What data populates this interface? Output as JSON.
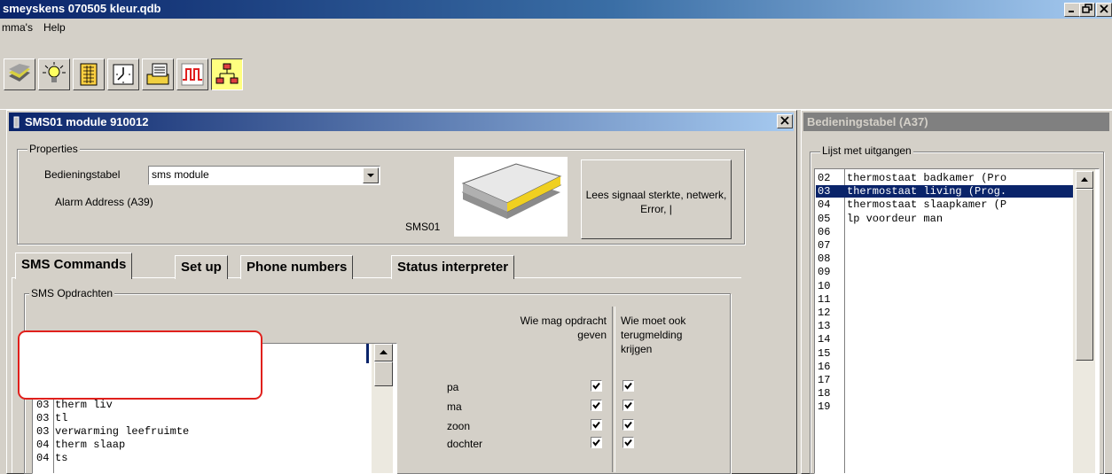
{
  "window": {
    "title": "smeyskens 070505 kleur.qdb",
    "min": "_",
    "max": "□",
    "close": "×"
  },
  "menu": [
    "mma's",
    "Help"
  ],
  "toolbar": {
    "icons": [
      "modules-icon",
      "lamp-icon",
      "table-icon",
      "clock-icon",
      "list-icon",
      "graph-icon",
      "network-icon"
    ]
  },
  "module": {
    "title": "SMS01 module 910012",
    "properties_legend": "Properties",
    "bedieningstabel_label": "Bedieningstabel",
    "bedieningstabel_value": "sms module",
    "alarm_address": "Alarm Address (A39)",
    "device_label": "SMS01",
    "signal_button": "Lees signaal sterkte, netwerk, Error, |"
  },
  "tabs": [
    "SMS Commands",
    "Set up",
    "Phone numbers",
    "Status interpreter"
  ],
  "sms": {
    "legend": "SMS Opdrachten",
    "header_who_may": "Wie mag opdracht geven",
    "header_who_feedback": "Wie moet ook terugmelding krijgen",
    "commands": [
      {
        "num": "03",
        "text": "therm liv"
      },
      {
        "num": "03",
        "text": "tl"
      },
      {
        "num": "03",
        "text": "verwarming leefruimte"
      },
      {
        "num": "04",
        "text": "therm slaap"
      },
      {
        "num": "04",
        "text": "ts"
      }
    ],
    "people": [
      {
        "name": "pa",
        "may": true,
        "feedback": true
      },
      {
        "name": "ma",
        "may": true,
        "feedback": true
      },
      {
        "name": "zoon",
        "may": true,
        "feedback": true
      },
      {
        "name": "dochter",
        "may": true,
        "feedback": true
      }
    ]
  },
  "control_table": {
    "title": "Bedieningstabel (A37)",
    "legend": "Lijst met uitgangen",
    "rows": [
      {
        "num": "02",
        "text": "thermostaat badkamer (Pro"
      },
      {
        "num": "03",
        "text": "thermostaat living (Prog.",
        "selected": true
      },
      {
        "num": "04",
        "text": "thermostaat slaapkamer (P"
      },
      {
        "num": "05",
        "text": "lp voordeur man"
      },
      {
        "num": "06",
        "text": ""
      },
      {
        "num": "07",
        "text": ""
      },
      {
        "num": "08",
        "text": ""
      },
      {
        "num": "09",
        "text": ""
      },
      {
        "num": "10",
        "text": ""
      },
      {
        "num": "11",
        "text": ""
      },
      {
        "num": "12",
        "text": ""
      },
      {
        "num": "13",
        "text": ""
      },
      {
        "num": "14",
        "text": ""
      },
      {
        "num": "15",
        "text": ""
      },
      {
        "num": "16",
        "text": ""
      },
      {
        "num": "17",
        "text": ""
      },
      {
        "num": "18",
        "text": ""
      },
      {
        "num": "19",
        "text": ""
      }
    ]
  },
  "colors": {
    "title_active": "#0a246a",
    "title_inactive": "#808080",
    "highlight_outline": "#e0201c",
    "selection": "#0a246a"
  }
}
